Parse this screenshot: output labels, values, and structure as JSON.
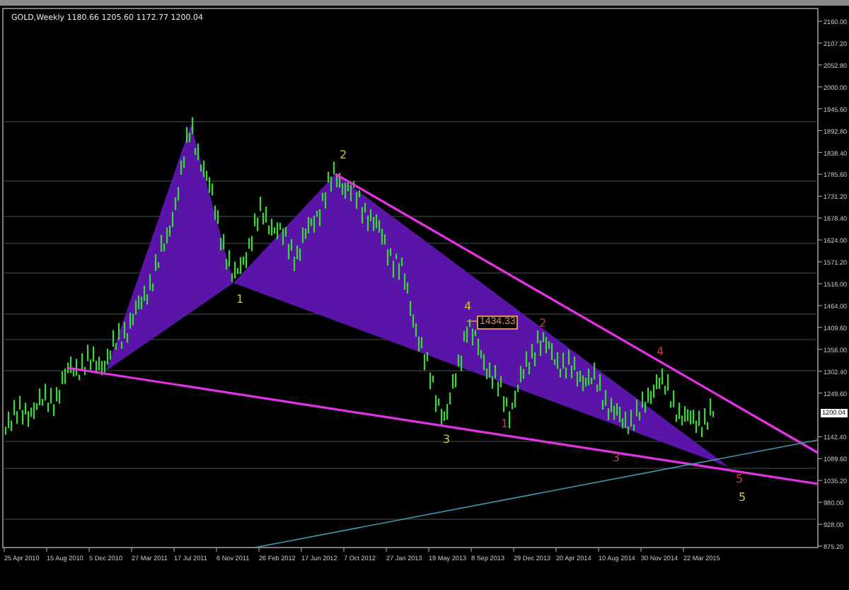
{
  "chart": {
    "title": "GOLD,Weekly  1180.66 1205.60 1172.77 1200.04",
    "price_axis": [
      "2160.00",
      "2107.20",
      "2052.80",
      "2000.00",
      "1945.60",
      "1892.80",
      "1838.40",
      "1785.60",
      "1731.20",
      "1678.40",
      "1624.00",
      "1571.20",
      "1516.00",
      "1464.00",
      "1409.60",
      "1356.00",
      "1302.40",
      "1249.60",
      "1142.40",
      "1089.60",
      "1035.20",
      "980.00",
      "928.00",
      "875.20"
    ],
    "current_price": "1200.04",
    "date_axis": [
      "25 Apr 2010",
      "15 Aug 2010",
      "5 Dec 2010",
      "27 Mar 2011",
      "17 Jul 2011",
      "6 Nov 2011",
      "26 Feb 2012",
      "17 Jun 2012",
      "7 Oct 2012",
      "27 Jan 2013",
      "19 May 2013",
      "8 Sep 2013",
      "29 Dec 2013",
      "20 Apr 2014",
      "10 Aug 2014",
      "30 Nov 2014",
      "22 Mar 2015"
    ],
    "price_label": "1434.33",
    "wave_labels": [
      {
        "text": "2",
        "color": "#c8c832"
      },
      {
        "text": "1",
        "color": "#c8c832"
      },
      {
        "text": "4",
        "color": "#c8c832"
      },
      {
        "text": "3",
        "color": "#c8c832"
      },
      {
        "text": "5",
        "color": "#c8c832"
      },
      {
        "text": "2",
        "color": "#c83c3c"
      },
      {
        "text": "4",
        "color": "#c83c3c"
      },
      {
        "text": "1",
        "color": "#c83c3c"
      },
      {
        "text": "3",
        "color": "#c83c3c"
      },
      {
        "text": "5",
        "color": "#c83c3c"
      }
    ]
  }
}
